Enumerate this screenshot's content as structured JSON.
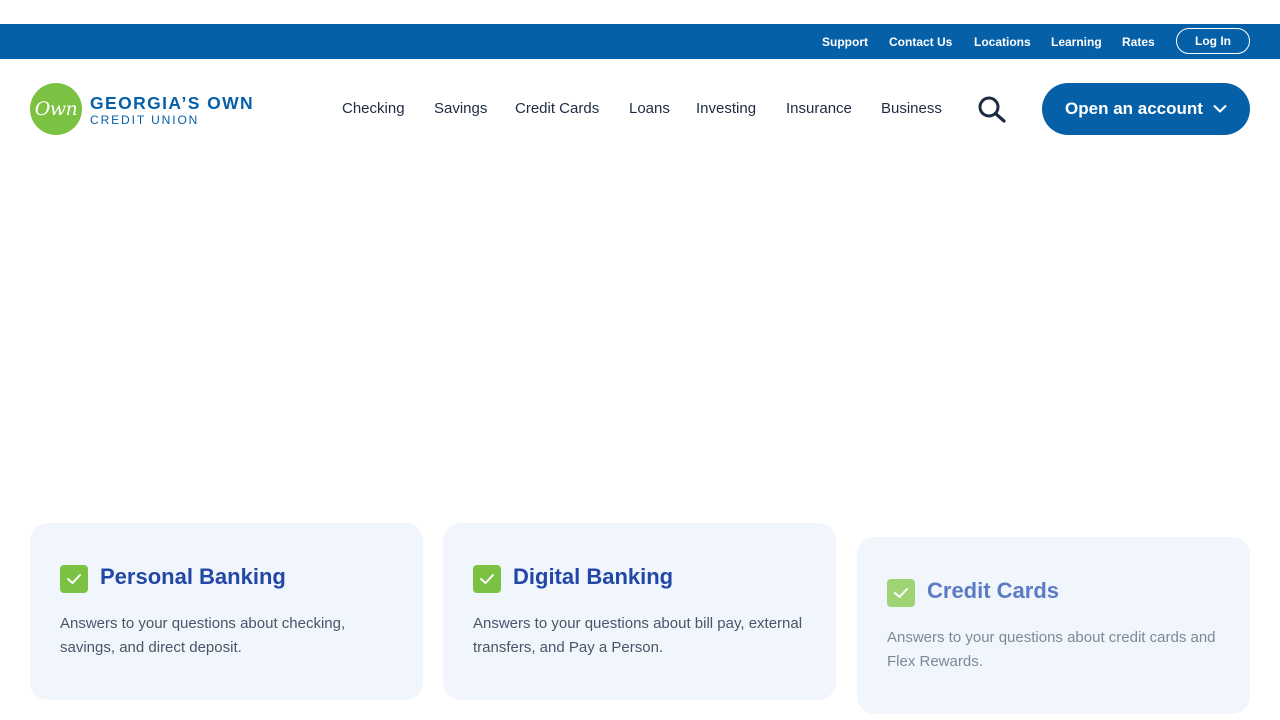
{
  "utility_nav": {
    "links": [
      "Support",
      "Contact Us",
      "Locations",
      "Learning",
      "Rates"
    ],
    "login_label": "Log In"
  },
  "brand": {
    "logo_mark": "Own",
    "name_line1": "GEORGIA’S OWN",
    "name_line2": "CREDIT UNION"
  },
  "main_nav": {
    "items": [
      "Checking",
      "Savings",
      "Credit Cards",
      "Loans",
      "Investing",
      "Insurance",
      "Business"
    ],
    "search_icon": "search-icon",
    "cta_label": "Open an account",
    "cta_icon": "chevron-down-icon"
  },
  "cards": [
    {
      "title": "Personal Banking",
      "description": "Answers to your questions about checking, savings, and direct deposit.",
      "icon": "checkmark-icon"
    },
    {
      "title": "Digital Banking",
      "description": "Answers to your questions about bill pay, external transfers, and Pay a Person.",
      "icon": "checkmark-icon"
    },
    {
      "title": "Credit Cards",
      "description": "Answers to your questions about credit cards and Flex Rewards.",
      "icon": "checkmark-icon"
    }
  ],
  "colors": {
    "brand_blue": "#0560a8",
    "brand_green": "#7cc242",
    "card_title_blue": "#2347a6",
    "card_background": "#f1f6fc"
  }
}
